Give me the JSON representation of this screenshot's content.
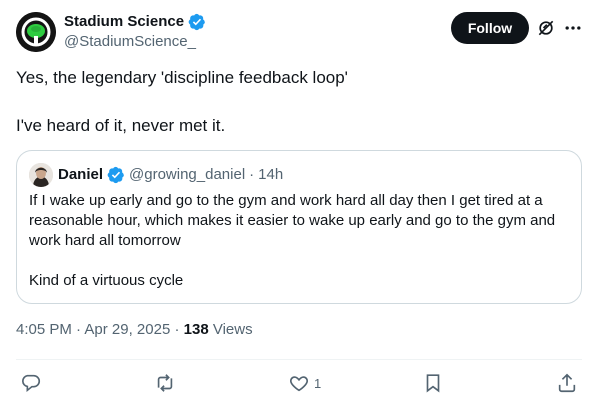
{
  "author": {
    "name": "Stadium Science",
    "handle": "@StadiumScience_",
    "verified": true
  },
  "header": {
    "follow_label": "Follow"
  },
  "tweet": {
    "lines": [
      "Yes, the legendary 'discipline feedback loop'",
      "",
      "I've heard of it, never met it."
    ]
  },
  "quoted": {
    "name": "Daniel",
    "handle": "@growing_daniel",
    "time": "14h",
    "separator": "·",
    "verified": true,
    "lines": [
      "If I wake up early and go to the gym and work hard all day then I get tired at a reasonable hour, which makes it easier to wake up early and go to the gym and work hard all tomorrow",
      "",
      "Kind of a virtuous cycle"
    ]
  },
  "meta": {
    "time": "4:05 PM",
    "date": "Apr 29, 2025",
    "separator": "·",
    "views_count": "138",
    "views_label": "Views"
  },
  "actions": {
    "reply_count": "",
    "repost_count": "",
    "like_count": "1",
    "bookmark_count": ""
  },
  "colors": {
    "verified": "#1d9bf0",
    "text": "#0f1419",
    "muted": "#536471",
    "border": "#cfd9de",
    "follow_bg": "#0f1419"
  }
}
